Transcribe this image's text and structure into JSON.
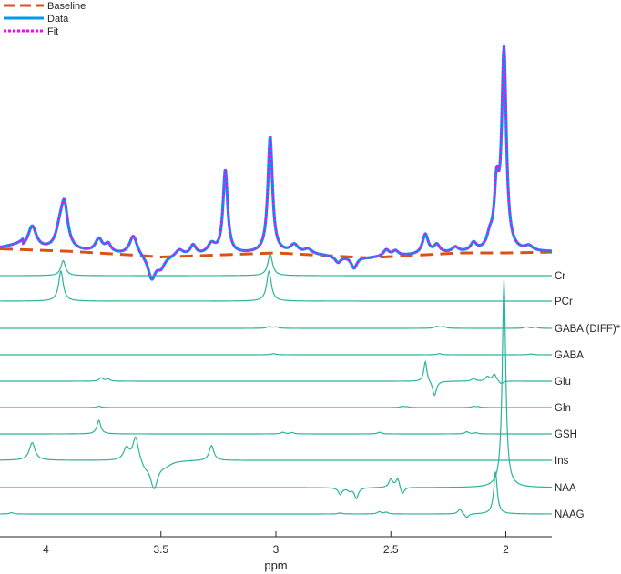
{
  "chart_data": {
    "type": "line",
    "title": "",
    "xlabel": "ppm",
    "ylabel": "",
    "x_reversed": true,
    "xlim": [
      4.2,
      1.8
    ],
    "x_ticks": [
      4,
      3.5,
      3,
      2.5,
      2
    ],
    "x_tick_labels": [
      "4",
      "3.5",
      "3",
      "2.5",
      "2"
    ],
    "grid": false,
    "legend_position": "top-left",
    "legend": [
      {
        "name": "Baseline",
        "style": "dashed",
        "color": "#D95319"
      },
      {
        "name": "Data",
        "style": "solid",
        "color": "#0099E6"
      },
      {
        "name": "Fit",
        "style": "dotted",
        "color": "#FF00FF"
      }
    ],
    "spectrum": {
      "baseline": {
        "type": "polyline",
        "points": [
          [
            4.2,
            0.05
          ],
          [
            3.9,
            0.02
          ],
          [
            3.6,
            -0.03
          ],
          [
            3.5,
            -0.05
          ],
          [
            3.4,
            -0.04
          ],
          [
            3.2,
            -0.02
          ],
          [
            3,
            0.0
          ],
          [
            2.8,
            -0.03
          ],
          [
            2.6,
            -0.06
          ],
          [
            2.4,
            -0.03
          ],
          [
            2.2,
            0.0
          ],
          [
            2.0,
            0.0
          ],
          [
            1.8,
            0.01
          ]
        ]
      },
      "components": [
        {
          "type": "polyline",
          "points": [
            [
              4.2,
              0.06
            ],
            [
              4.15,
              0.08
            ],
            [
              4.1,
              0.1
            ]
          ]
        },
        {
          "type": "lorentz",
          "center": 4.06,
          "height": 0.28,
          "width": 0.022
        },
        {
          "type": "lorentz",
          "center": 3.94,
          "height": 0.2,
          "width": 0.02
        },
        {
          "type": "lorentz",
          "center": 3.92,
          "height": 0.52,
          "width": 0.018
        },
        {
          "type": "lorentz",
          "center": 3.77,
          "height": 0.16,
          "width": 0.018
        },
        {
          "type": "lorentz",
          "center": 3.73,
          "height": 0.1,
          "width": 0.015
        },
        {
          "type": "lorentz",
          "center": 3.62,
          "height": 0.24,
          "width": 0.02
        },
        {
          "type": "lorentz",
          "center": 3.54,
          "height": -0.28,
          "width": 0.02
        },
        {
          "type": "lorentz",
          "center": 3.5,
          "height": -0.12,
          "width": 0.02
        },
        {
          "type": "lorentz",
          "center": 3.42,
          "height": 0.08,
          "width": 0.02
        },
        {
          "type": "lorentz",
          "center": 3.36,
          "height": 0.12,
          "width": 0.015
        },
        {
          "type": "lorentz",
          "center": 3.28,
          "height": 0.12,
          "width": 0.02
        },
        {
          "type": "lorentz",
          "center": 3.22,
          "height": 1.02,
          "width": 0.012
        },
        {
          "type": "lorentz",
          "center": 3.025,
          "height": 1.42,
          "width": 0.012
        },
        {
          "type": "lorentz",
          "center": 2.92,
          "height": 0.1,
          "width": 0.02
        },
        {
          "type": "lorentz",
          "center": 2.86,
          "height": 0.06,
          "width": 0.02
        },
        {
          "type": "lorentz",
          "center": 2.73,
          "height": -0.08,
          "width": 0.015
        },
        {
          "type": "lorentz",
          "center": 2.66,
          "height": -0.14,
          "width": 0.015
        },
        {
          "type": "lorentz",
          "center": 2.52,
          "height": 0.08,
          "width": 0.015
        },
        {
          "type": "lorentz",
          "center": 2.48,
          "height": 0.06,
          "width": 0.015
        },
        {
          "type": "lorentz",
          "center": 2.35,
          "height": 0.24,
          "width": 0.015
        },
        {
          "type": "lorentz",
          "center": 2.3,
          "height": 0.1,
          "width": 0.015
        },
        {
          "type": "lorentz",
          "center": 2.22,
          "height": 0.06,
          "width": 0.015
        },
        {
          "type": "lorentz",
          "center": 2.14,
          "height": 0.1,
          "width": 0.015
        },
        {
          "type": "lorentz",
          "center": 2.07,
          "height": 0.14,
          "width": 0.015
        },
        {
          "type": "lorentz",
          "center": 2.04,
          "height": 0.72,
          "width": 0.012
        },
        {
          "type": "lorentz",
          "center": 2.008,
          "height": 2.42,
          "width": 0.012
        },
        {
          "type": "lorentz",
          "center": 1.9,
          "height": 0.06,
          "width": 0.02
        }
      ]
    },
    "metabolites": [
      {
        "name": "Cr",
        "components": [
          {
            "type": "lorentz",
            "center": 3.925,
            "height": 0.55,
            "width": 0.012
          },
          {
            "type": "lorentz",
            "center": 3.025,
            "height": 0.8,
            "width": 0.012
          }
        ]
      },
      {
        "name": "PCr",
        "components": [
          {
            "type": "lorentz",
            "center": 3.935,
            "height": 1.1,
            "width": 0.012
          },
          {
            "type": "lorentz",
            "center": 3.03,
            "height": 1.1,
            "width": 0.012
          }
        ]
      },
      {
        "name": "GABA (DIFF)*",
        "components": [
          {
            "type": "lorentz",
            "center": 3.03,
            "height": 0.06,
            "width": 0.012
          },
          {
            "type": "lorentz",
            "center": 3.0,
            "height": 0.05,
            "width": 0.012
          },
          {
            "type": "lorentz",
            "center": 2.3,
            "height": 0.07,
            "width": 0.012
          },
          {
            "type": "lorentz",
            "center": 2.27,
            "height": 0.06,
            "width": 0.012
          },
          {
            "type": "lorentz",
            "center": 1.91,
            "height": 0.05,
            "width": 0.012
          },
          {
            "type": "lorentz",
            "center": 1.87,
            "height": 0.04,
            "width": 0.012
          }
        ]
      },
      {
        "name": "GABA",
        "components": [
          {
            "type": "lorentz",
            "center": 3.01,
            "height": 0.04,
            "width": 0.012
          },
          {
            "type": "lorentz",
            "center": 2.29,
            "height": 0.04,
            "width": 0.012
          },
          {
            "type": "lorentz",
            "center": 1.89,
            "height": 0.03,
            "width": 0.012
          }
        ]
      },
      {
        "name": "Glu",
        "components": [
          {
            "type": "lorentz",
            "center": 3.76,
            "height": 0.12,
            "width": 0.01
          },
          {
            "type": "lorentz",
            "center": 3.73,
            "height": 0.08,
            "width": 0.01
          },
          {
            "type": "lorentz",
            "center": 2.35,
            "height": 0.75,
            "width": 0.008
          },
          {
            "type": "lorentz",
            "center": 2.31,
            "height": -0.55,
            "width": 0.01
          },
          {
            "type": "lorentz",
            "center": 2.14,
            "height": 0.1,
            "width": 0.01
          },
          {
            "type": "lorentz",
            "center": 2.08,
            "height": 0.16,
            "width": 0.01
          },
          {
            "type": "lorentz",
            "center": 2.05,
            "height": 0.26,
            "width": 0.01
          },
          {
            "type": "lorentz",
            "center": 2.02,
            "height": -0.12,
            "width": 0.01
          }
        ]
      },
      {
        "name": "Gln",
        "components": [
          {
            "type": "lorentz",
            "center": 3.77,
            "height": 0.05,
            "width": 0.01
          },
          {
            "type": "lorentz",
            "center": 2.45,
            "height": 0.04,
            "width": 0.01
          },
          {
            "type": "lorentz",
            "center": 2.43,
            "height": 0.03,
            "width": 0.01
          },
          {
            "type": "lorentz",
            "center": 2.14,
            "height": 0.04,
            "width": 0.01
          },
          {
            "type": "lorentz",
            "center": 2.12,
            "height": 0.03,
            "width": 0.01
          }
        ]
      },
      {
        "name": "GSH",
        "components": [
          {
            "type": "lorentz",
            "center": 3.77,
            "height": 0.5,
            "width": 0.01
          },
          {
            "type": "lorentz",
            "center": 2.97,
            "height": 0.06,
            "width": 0.01
          },
          {
            "type": "lorentz",
            "center": 2.93,
            "height": 0.05,
            "width": 0.01
          },
          {
            "type": "lorentz",
            "center": 2.55,
            "height": 0.06,
            "width": 0.01
          },
          {
            "type": "lorentz",
            "center": 2.17,
            "height": 0.08,
            "width": 0.01
          },
          {
            "type": "lorentz",
            "center": 2.13,
            "height": 0.04,
            "width": 0.01
          }
        ]
      },
      {
        "name": "Ins",
        "components": [
          {
            "type": "lorentz",
            "center": 4.06,
            "height": 0.65,
            "width": 0.015
          },
          {
            "type": "lorentz",
            "center": 3.65,
            "height": 0.45,
            "width": 0.015
          },
          {
            "type": "lorentz",
            "center": 3.61,
            "height": 0.9,
            "width": 0.015
          },
          {
            "type": "lorentz",
            "center": 3.57,
            "height": -0.2,
            "width": 0.02
          },
          {
            "type": "lorentz",
            "center": 3.53,
            "height": -1.0,
            "width": 0.02
          },
          {
            "type": "lorentz",
            "center": 3.48,
            "height": -0.15,
            "width": 0.03
          },
          {
            "type": "lorentz",
            "center": 3.28,
            "height": 0.55,
            "width": 0.012
          }
        ]
      },
      {
        "name": "NAA",
        "components": [
          {
            "type": "lorentz",
            "center": 2.72,
            "height": -0.25,
            "width": 0.01
          },
          {
            "type": "lorentz",
            "center": 2.68,
            "height": -0.1,
            "width": 0.01
          },
          {
            "type": "lorentz",
            "center": 2.65,
            "height": -0.4,
            "width": 0.01
          },
          {
            "type": "lorentz",
            "center": 2.5,
            "height": 0.3,
            "width": 0.01
          },
          {
            "type": "lorentz",
            "center": 2.47,
            "height": 0.35,
            "width": 0.01
          },
          {
            "type": "lorentz",
            "center": 2.45,
            "height": -0.3,
            "width": 0.01
          },
          {
            "type": "lorentz",
            "center": 2.008,
            "height": 7.6,
            "width": 0.009
          }
        ]
      },
      {
        "name": "NAAG",
        "components": [
          {
            "type": "lorentz",
            "center": 4.15,
            "height": 0.05,
            "width": 0.01
          },
          {
            "type": "lorentz",
            "center": 2.72,
            "height": 0.04,
            "width": 0.01
          },
          {
            "type": "lorentz",
            "center": 2.55,
            "height": 0.08,
            "width": 0.01
          },
          {
            "type": "lorentz",
            "center": 2.52,
            "height": 0.06,
            "width": 0.01
          },
          {
            "type": "lorentz",
            "center": 2.2,
            "height": 0.18,
            "width": 0.01
          },
          {
            "type": "lorentz",
            "center": 2.17,
            "height": -0.15,
            "width": 0.01
          },
          {
            "type": "lorentz",
            "center": 2.045,
            "height": 1.55,
            "width": 0.009
          }
        ]
      }
    ]
  },
  "colors": {
    "baseline": "#D95319",
    "data": "#0099E6",
    "fit": "#FF00FF",
    "metabolite": "#2DB39A",
    "axis": "#262626",
    "background": "#FFFFFF"
  }
}
